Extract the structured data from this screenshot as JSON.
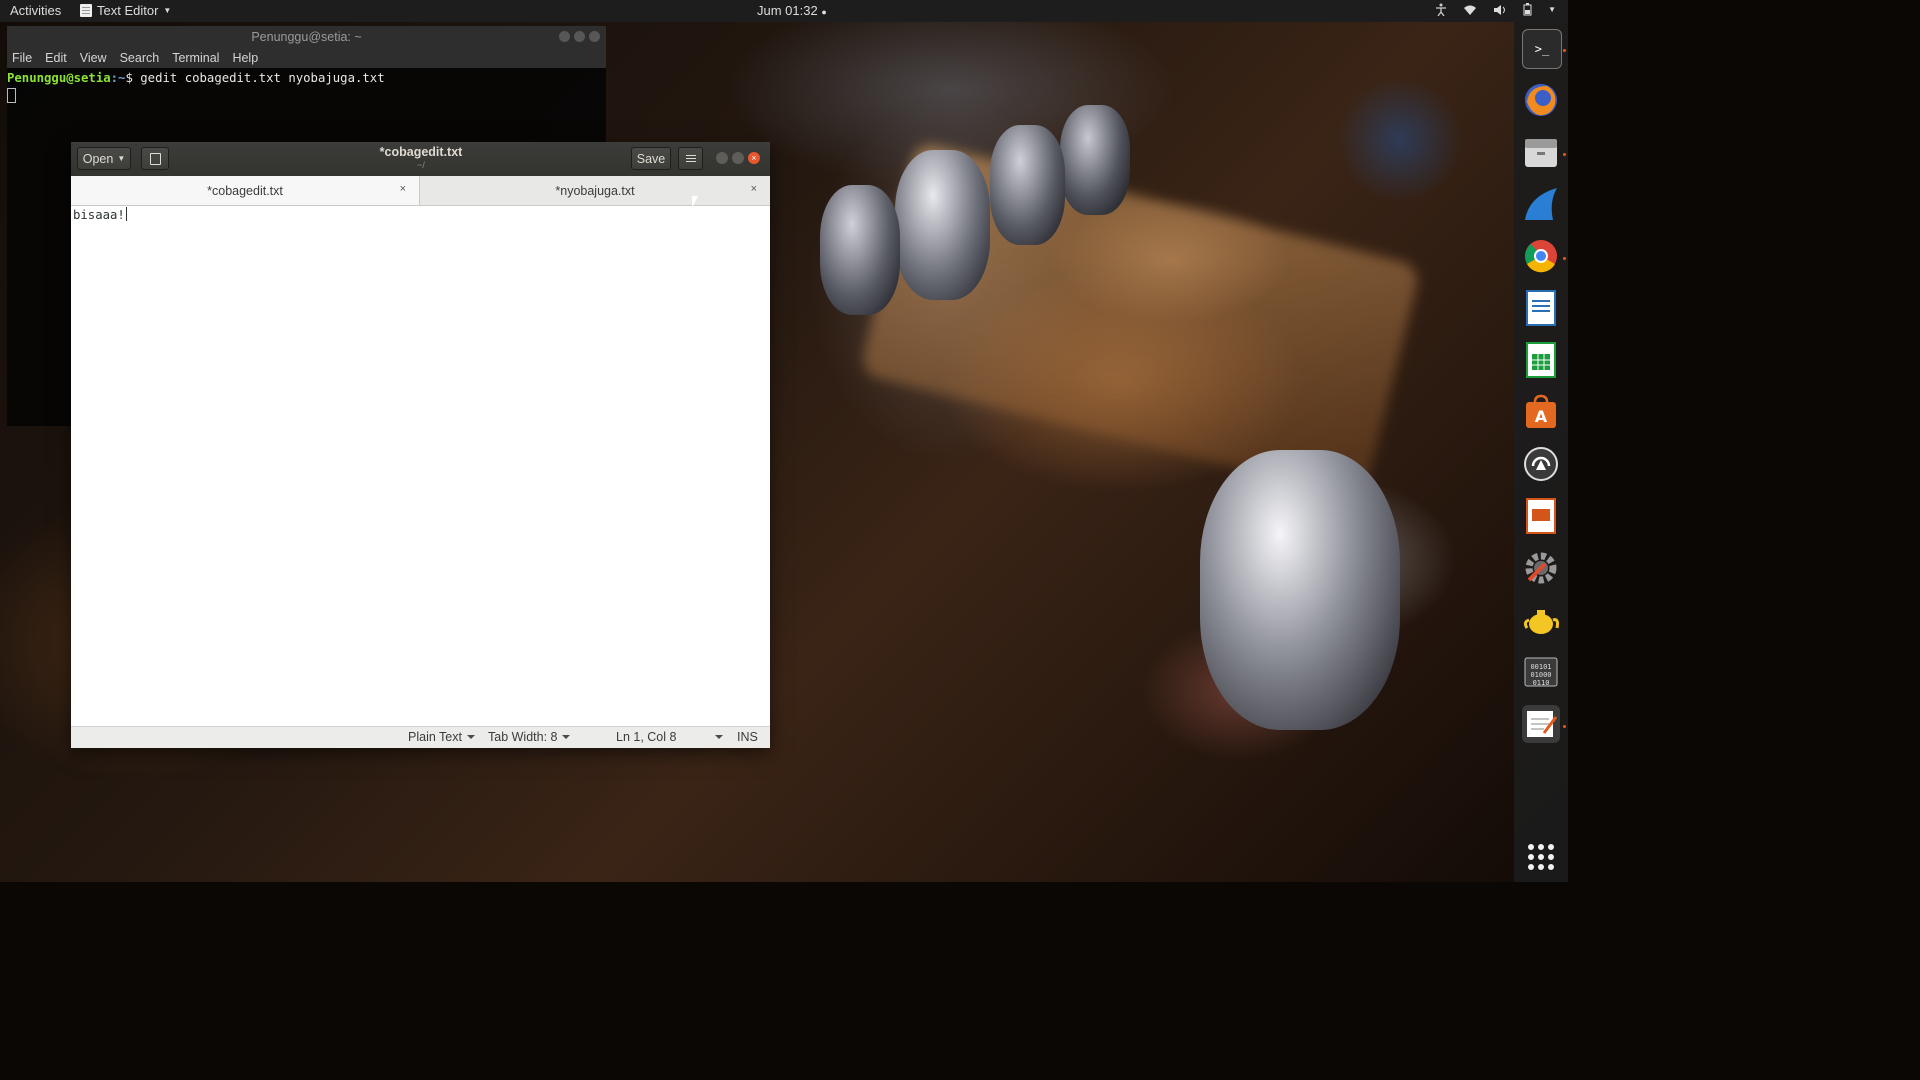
{
  "topbar": {
    "activities": "Activities",
    "app_name": "Text Editor",
    "clock": "Jum 01:32"
  },
  "terminal": {
    "title": "Penunggu@setia: ~",
    "menu": [
      "File",
      "Edit",
      "View",
      "Search",
      "Terminal",
      "Help"
    ],
    "prompt_user": "Penunggu@setia",
    "prompt_path": ":~",
    "prompt_symbol": "$",
    "command": "gedit cobagedit.txt nyobajuga.txt"
  },
  "gedit": {
    "open_label": "Open",
    "save_label": "Save",
    "title": "*cobagedit.txt",
    "subtitle": "~/",
    "tabs": [
      {
        "label": "*cobagedit.txt",
        "active": true
      },
      {
        "label": "*nyobajuga.txt",
        "active": false
      }
    ],
    "content": "bisaaa!",
    "status": {
      "language": "Plain Text",
      "tab_width": "Tab Width: 8",
      "position": "Ln 1, Col 8",
      "mode": "INS"
    }
  },
  "dock": {
    "items": [
      "terminal-icon",
      "firefox-icon",
      "files-icon",
      "browser-shark-icon",
      "chrome-icon",
      "writer-icon",
      "calc-icon",
      "software-center-icon",
      "update-icon",
      "impress-icon",
      "settings-icon",
      "teapot-icon",
      "hex-editor-icon",
      "text-editor-icon"
    ]
  }
}
